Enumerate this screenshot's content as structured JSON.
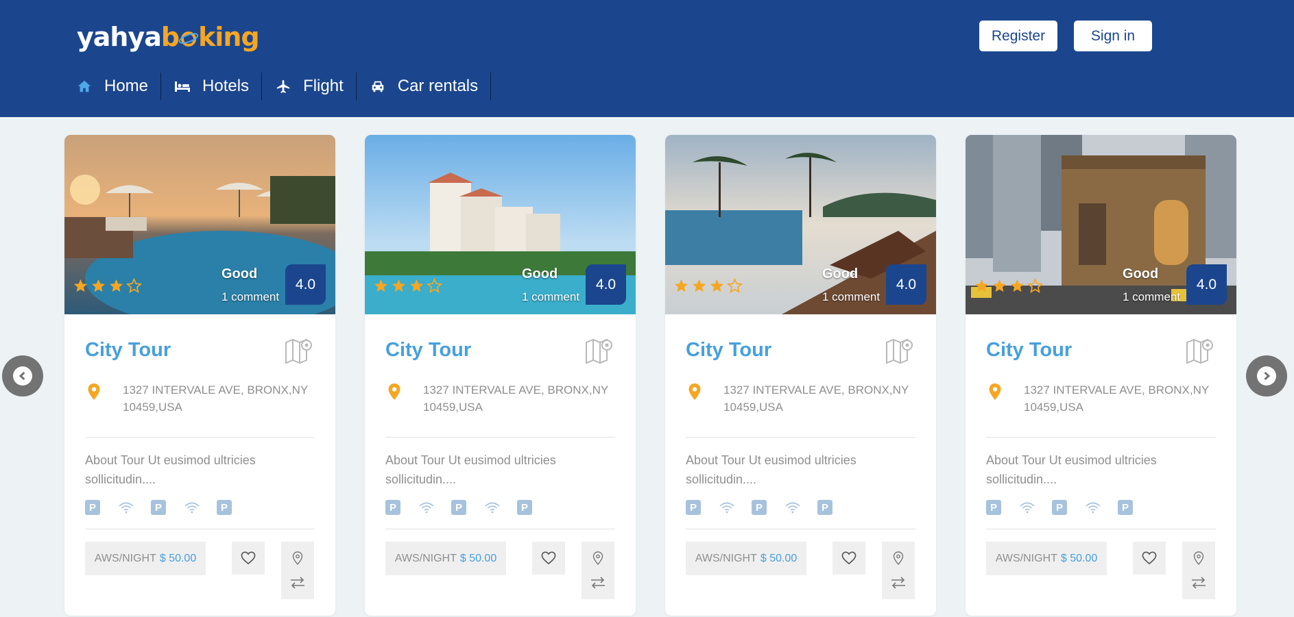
{
  "brand": {
    "part1": "yahya",
    "part2": "b",
    "part3": "king"
  },
  "header": {
    "register_label": "Register",
    "signin_label": "Sign in"
  },
  "nav": [
    {
      "label": "Home",
      "icon": "home-icon"
    },
    {
      "label": "Hotels",
      "icon": "bed-icon"
    },
    {
      "label": "Flight",
      "icon": "plane-icon"
    },
    {
      "label": "Car rentals",
      "icon": "car-icon"
    }
  ],
  "colors": {
    "header": "#1b468e",
    "accent": "#46a0de",
    "star": "#f5a623",
    "background": "#edf3f5"
  },
  "cards": [
    {
      "title": "City Tour",
      "rating_word": "Good",
      "comments": "1 comment",
      "score": "4.0",
      "stars": 3,
      "address": "1327 INTERVALE AVE, BRONX,NY 10459,USA",
      "about": "About Tour Ut eusimod ultricies sollicitudin....",
      "price_label": "AWS/NIGHT",
      "price_value": "$ 50.00"
    },
    {
      "title": "City Tour",
      "rating_word": "Good",
      "comments": "1 comment",
      "score": "4.0",
      "stars": 3,
      "address": "1327 INTERVALE AVE, BRONX,NY 10459,USA",
      "about": "About Tour Ut eusimod ultricies sollicitudin....",
      "price_label": "AWS/NIGHT",
      "price_value": "$ 50.00"
    },
    {
      "title": "City Tour",
      "rating_word": "Good",
      "comments": "1 comment",
      "score": "4.0",
      "stars": 3,
      "address": "1327 INTERVALE AVE, BRONX,NY 10459,USA",
      "about": "About Tour Ut eusimod ultricies sollicitudin....",
      "price_label": "AWS/NIGHT",
      "price_value": "$ 50.00"
    },
    {
      "title": "City Tour",
      "rating_word": "Good",
      "comments": "1 comment",
      "score": "4.0",
      "stars": 3,
      "address": "1327 INTERVALE AVE, BRONX,NY 10459,USA",
      "about": "About Tour Ut eusimod ultricies sollicitudin....",
      "price_label": "AWS/NIGHT",
      "price_value": "$ 50.00"
    }
  ],
  "amenities": [
    "parking-icon",
    "wifi-icon",
    "parking-icon",
    "wifi-icon",
    "parking-icon"
  ],
  "amenity_letter": "P"
}
